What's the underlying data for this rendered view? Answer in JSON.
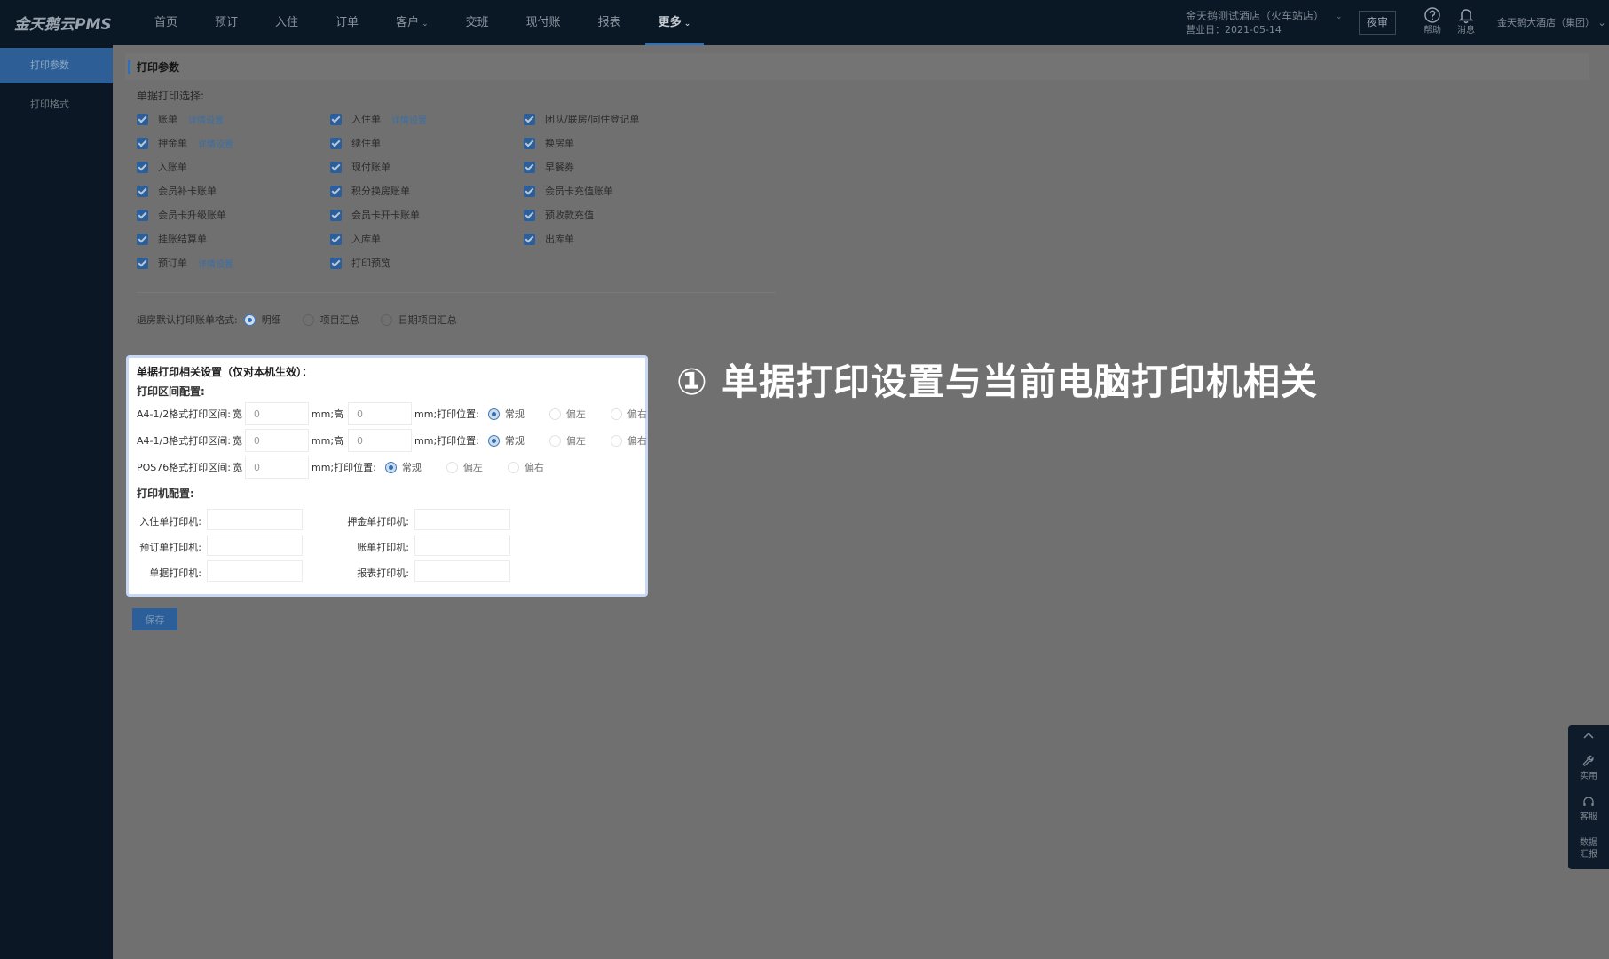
{
  "app": {
    "logo": "金天鹅云PMS"
  },
  "nav": {
    "items": [
      {
        "label": "首页",
        "caret": ""
      },
      {
        "label": "预订",
        "caret": ""
      },
      {
        "label": "入住",
        "caret": ""
      },
      {
        "label": "订单",
        "caret": ""
      },
      {
        "label": "客户",
        "caret": "⌄"
      },
      {
        "label": "交班",
        "caret": ""
      },
      {
        "label": "现付账",
        "caret": ""
      },
      {
        "label": "报表",
        "caret": ""
      },
      {
        "label": "更多",
        "caret": "⌄"
      }
    ]
  },
  "header": {
    "hotel": "金天鹅测试酒店（火车站店）",
    "business_date": "营业日：2021-05-14",
    "night_audit": "夜审",
    "help": "帮助",
    "message": "消息",
    "group": "金天鹅大酒店（集团）",
    "caret": "⌄"
  },
  "sidebar": {
    "items": [
      "打印参数",
      "打印格式"
    ]
  },
  "section": {
    "title": "打印参数"
  },
  "print_select": {
    "label": "单据打印选择:",
    "col1": [
      {
        "label": "账单",
        "link": "详情设置"
      },
      {
        "label": "押金单",
        "link": "详情设置"
      },
      {
        "label": "入账单",
        "link": ""
      },
      {
        "label": "会员补卡账单",
        "link": ""
      },
      {
        "label": "会员卡升级账单",
        "link": ""
      },
      {
        "label": "挂账结算单",
        "link": ""
      },
      {
        "label": "预订单",
        "link": "详情设置"
      }
    ],
    "col2": [
      {
        "label": "入住单",
        "link": "详情设置"
      },
      {
        "label": "续住单",
        "link": ""
      },
      {
        "label": "现付账单",
        "link": ""
      },
      {
        "label": "积分换房账单",
        "link": ""
      },
      {
        "label": "会员卡开卡账单",
        "link": ""
      },
      {
        "label": "入库单",
        "link": ""
      },
      {
        "label": "打印预览",
        "link": ""
      }
    ],
    "col3": [
      {
        "label": "团队/联房/同住登记单",
        "link": ""
      },
      {
        "label": "换房单",
        "link": ""
      },
      {
        "label": "早餐券",
        "link": ""
      },
      {
        "label": "会员卡充值账单",
        "link": ""
      },
      {
        "label": "预收款充值",
        "link": ""
      },
      {
        "label": "出库单",
        "link": ""
      }
    ]
  },
  "checkout_format": {
    "label": "退房默认打印账单格式:",
    "options": [
      "明细",
      "项目汇总",
      "日期项目汇总"
    ],
    "selected": "明细"
  },
  "panel": {
    "title": "单据打印相关设置（仅对本机生效）：",
    "range_title": "打印区间配置:",
    "rows": [
      {
        "label": "A4-1/2格式打印区间:",
        "wide": "宽",
        "w_value": "0",
        "unit1": "mm;高",
        "h_value": "0",
        "unit2": "mm;打印位置:"
      },
      {
        "label": "A4-1/3格式打印区间:",
        "wide": "宽",
        "w_value": "0",
        "unit1": "mm;高",
        "h_value": "0",
        "unit2": "mm;打印位置:"
      }
    ],
    "pos_row": {
      "label": "POS76格式打印区间:",
      "wide": "宽",
      "w_value": "0",
      "unit": "mm;打印位置:"
    },
    "positions": [
      "常规",
      "偏左",
      "偏右"
    ],
    "printer_title": "打印机配置:",
    "printers_left": [
      "入住单打印机:",
      "预订单打印机:",
      "单据打印机:"
    ],
    "printers_right": [
      "押金单打印机:",
      "账单打印机:",
      "报表打印机:"
    ]
  },
  "save_label": "保存",
  "annotation": "① 单据打印设置与当前电脑打印机相关",
  "toolbox": {
    "tools": "实用",
    "service": "客服",
    "data_line1": "数据",
    "data_line2": "汇报"
  }
}
